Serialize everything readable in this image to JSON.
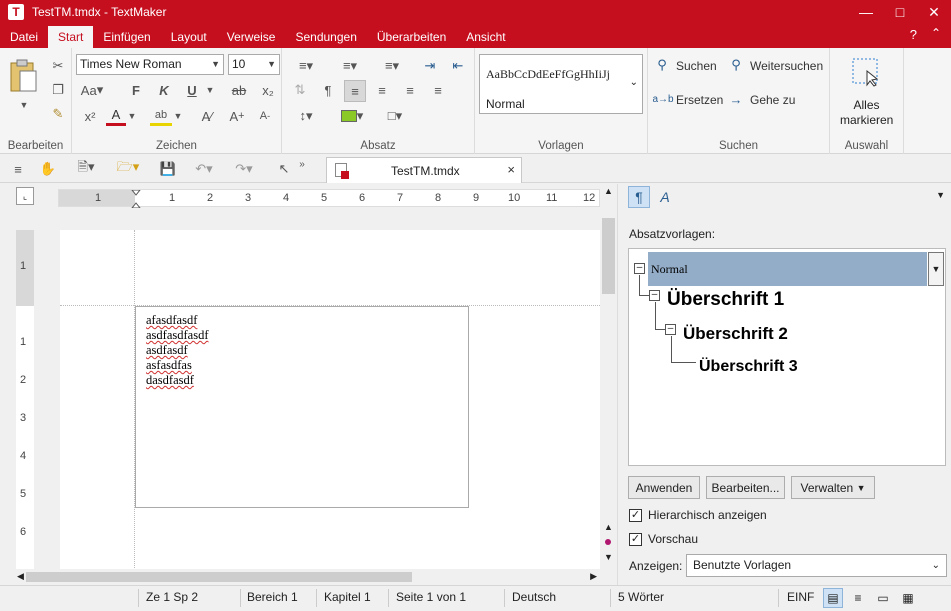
{
  "window": {
    "title": "TestTM.tmdx - TextMaker",
    "logo_letter": "T",
    "help": "?",
    "collapse": "^"
  },
  "menu": {
    "tabs": [
      "Datei",
      "Start",
      "Einfügen",
      "Layout",
      "Verweise",
      "Sendungen",
      "Überarbeiten",
      "Ansicht"
    ],
    "active": "Start"
  },
  "ribbon": {
    "groups": {
      "edit": "Bearbeiten",
      "chars": "Zeichen",
      "para": "Absatz",
      "styles": "Vorlagen",
      "search": "Suchen",
      "select": "Auswahl"
    },
    "font_name": "Times New Roman",
    "font_size": "10",
    "styles_preview": "AaBbCcDdEeFfGgHhIiJj",
    "styles_current": "Normal",
    "search_label": "Suchen",
    "search_next_label": "Weitersuchen",
    "replace_label": "Ersetzen",
    "goto_label": "Gehe zu",
    "select_all_label": "Alles markieren",
    "bold": "F",
    "italic": "K",
    "underline": "U",
    "strike": "ab",
    "sub": "x₂",
    "sup": "x²",
    "fontcolor": "A",
    "grow": "A",
    "shrink": "A",
    "case": "Aa",
    "pilcrow": "¶"
  },
  "toolbar": {
    "doc_tab_title": "TestTM.tmdx",
    "close": "×"
  },
  "document": {
    "lines": [
      "afasdfasdf",
      "asdfasdfasdf",
      "asdfasdf",
      "asfasdfas",
      "dasdfasdf"
    ],
    "hruler_numbers": [
      "1",
      "1",
      "2",
      "3",
      "4",
      "5",
      "6",
      "7",
      "8",
      "9",
      "10",
      "11",
      "12"
    ],
    "vruler_numbers": [
      "1",
      "1",
      "2",
      "3",
      "4",
      "5",
      "6"
    ]
  },
  "sidepanel": {
    "section_label": "Absatzvorlagen:",
    "tree": [
      "Normal",
      "Überschrift 1",
      "Überschrift 2",
      "Überschrift 3"
    ],
    "buttons": {
      "apply": "Anwenden",
      "edit": "Bearbeiten...",
      "manage": "Verwalten"
    },
    "hierarchical_label": "Hierarchisch anzeigen",
    "hierarchical_checked": true,
    "preview_label": "Vorschau",
    "preview_checked": true,
    "show_label": "Anzeigen:",
    "show_value": "Benutzte Vorlagen"
  },
  "status": {
    "position": "Ze 1 Sp 2",
    "section": "Bereich 1",
    "chapter": "Kapitel 1",
    "page": "Seite 1 von 1",
    "language": "Deutsch",
    "words": "5 Wörter",
    "mode": "EINF"
  },
  "colors": {
    "accent": "#c50f1f",
    "selection": "#93acc8"
  }
}
